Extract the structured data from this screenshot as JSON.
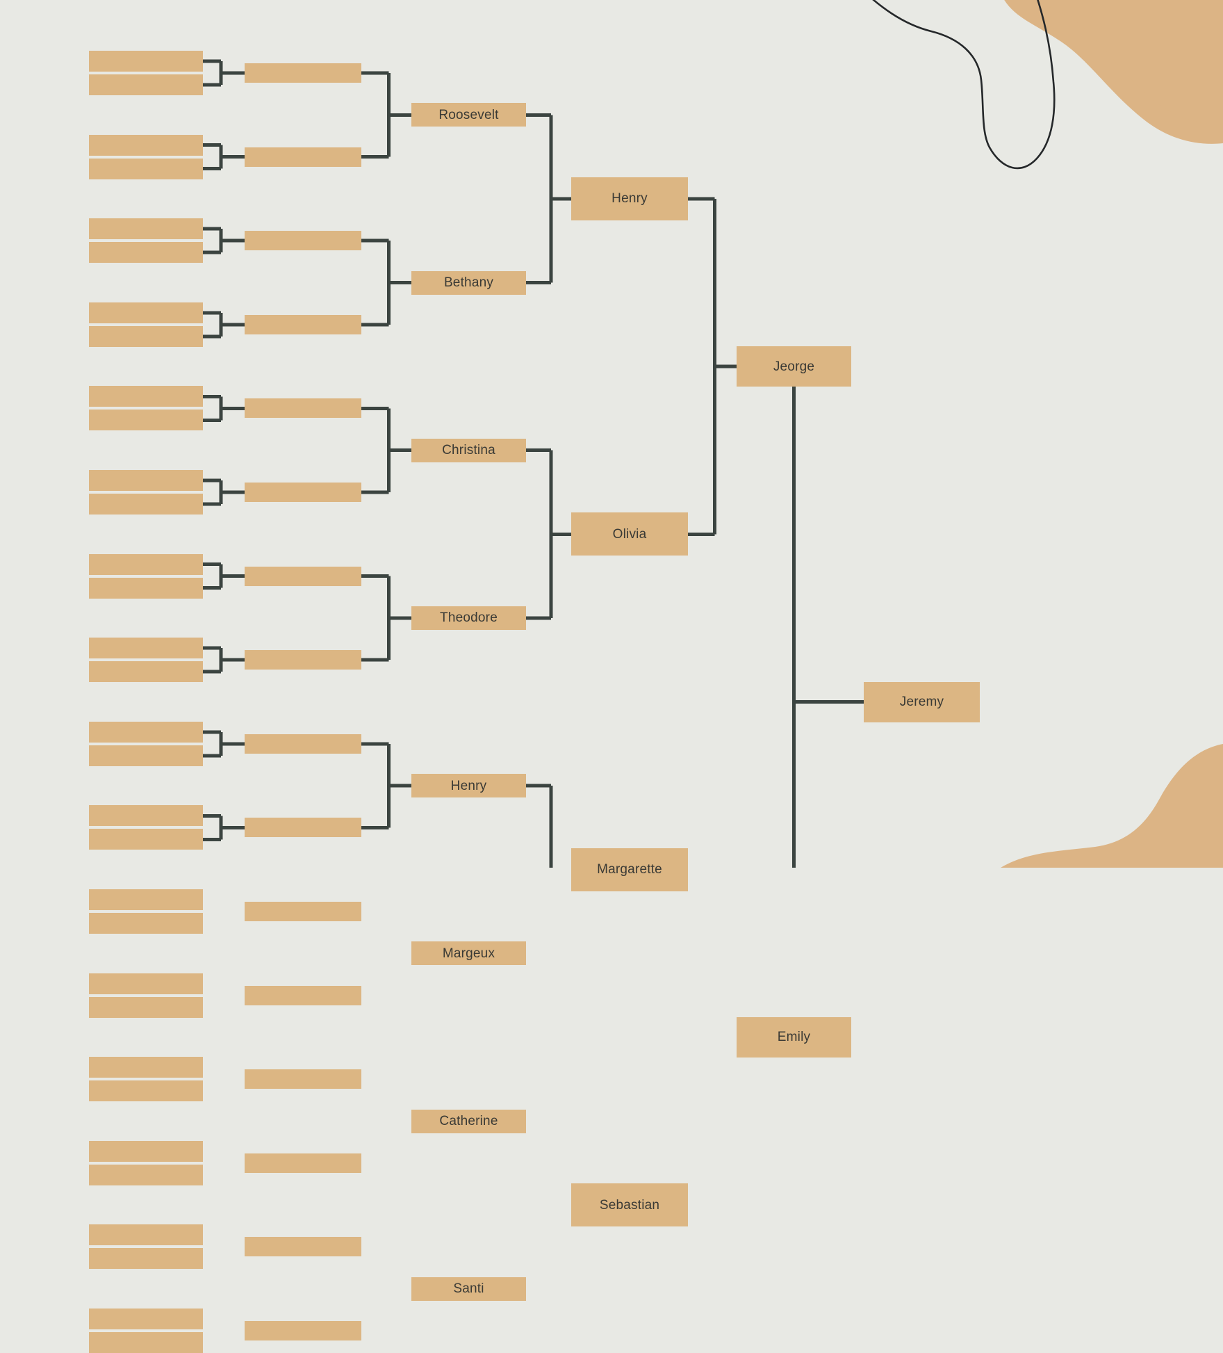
{
  "diagram": {
    "type": "single-elimination-tournament-bracket",
    "title": "",
    "background_color": "#e8e9e4",
    "node_color": "#dcb683",
    "line_color": "#3b4440",
    "text_color": "#3a3a35",
    "decor_color": "#dcb485",
    "decor_outline_color": "#25282a",
    "rounds": 6
  },
  "rounds": [
    {
      "name": "round-of-64",
      "index": 0,
      "labeled": false,
      "slot_count": 32,
      "slots": [
        {
          "label": ""
        },
        {
          "label": ""
        },
        {
          "label": ""
        },
        {
          "label": ""
        },
        {
          "label": ""
        },
        {
          "label": ""
        },
        {
          "label": ""
        },
        {
          "label": ""
        },
        {
          "label": ""
        },
        {
          "label": ""
        },
        {
          "label": ""
        },
        {
          "label": ""
        },
        {
          "label": ""
        },
        {
          "label": ""
        },
        {
          "label": ""
        },
        {
          "label": ""
        },
        {
          "label": ""
        },
        {
          "label": ""
        },
        {
          "label": ""
        },
        {
          "label": ""
        },
        {
          "label": ""
        },
        {
          "label": ""
        },
        {
          "label": ""
        },
        {
          "label": ""
        },
        {
          "label": ""
        },
        {
          "label": ""
        },
        {
          "label": ""
        },
        {
          "label": ""
        },
        {
          "label": ""
        },
        {
          "label": ""
        },
        {
          "label": ""
        },
        {
          "label": ""
        }
      ]
    },
    {
      "name": "round-of-32",
      "index": 1,
      "labeled": false,
      "slot_count": 16,
      "slots": [
        {
          "label": ""
        },
        {
          "label": ""
        },
        {
          "label": ""
        },
        {
          "label": ""
        },
        {
          "label": ""
        },
        {
          "label": ""
        },
        {
          "label": ""
        },
        {
          "label": ""
        },
        {
          "label": ""
        },
        {
          "label": ""
        },
        {
          "label": ""
        },
        {
          "label": ""
        },
        {
          "label": ""
        },
        {
          "label": ""
        },
        {
          "label": ""
        },
        {
          "label": ""
        }
      ]
    },
    {
      "name": "round-of-16",
      "index": 2,
      "labeled": true,
      "slot_count": 8,
      "slots": [
        {
          "label": "Roosevelt"
        },
        {
          "label": "Bethany"
        },
        {
          "label": "Christina"
        },
        {
          "label": "Theodore"
        },
        {
          "label": "Henry"
        },
        {
          "label": "Margeux"
        },
        {
          "label": "Catherine"
        },
        {
          "label": "Santi"
        }
      ]
    },
    {
      "name": "quarter-finals",
      "index": 3,
      "labeled": true,
      "slot_count": 4,
      "slots": [
        {
          "label": "Henry"
        },
        {
          "label": "Olivia"
        },
        {
          "label": "Margarette"
        },
        {
          "label": "Sebastian"
        }
      ]
    },
    {
      "name": "semi-finals",
      "index": 4,
      "labeled": true,
      "slot_count": 2,
      "slots": [
        {
          "label": "Jeorge"
        },
        {
          "label": "Emily"
        }
      ]
    },
    {
      "name": "final",
      "index": 5,
      "labeled": true,
      "slot_count": 1,
      "slots": [
        {
          "label": "Jeremy"
        }
      ]
    }
  ],
  "decorations": [
    {
      "name": "top-right-tan-blob",
      "color": "#dcb485"
    },
    {
      "name": "top-right-curved-outline",
      "color": "#25282a"
    },
    {
      "name": "bottom-right-tan-wave",
      "color": "#dcb485"
    }
  ]
}
